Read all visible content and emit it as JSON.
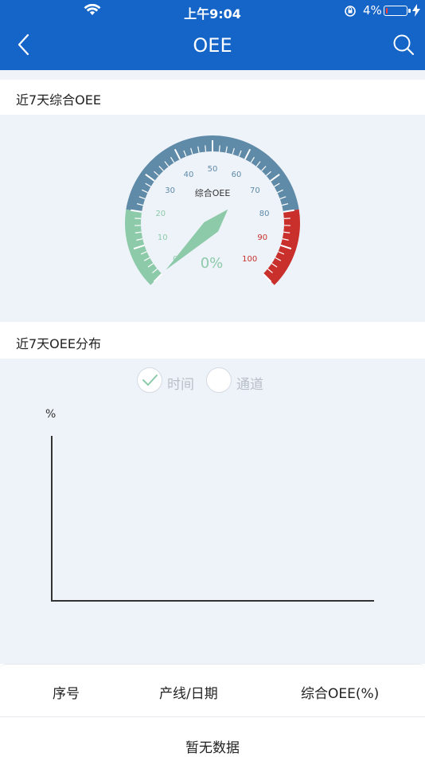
{
  "status_bar": {
    "time": "上午9:04",
    "battery_percent": "4%",
    "battery_level": 0.04,
    "icons": [
      "wifi-icon",
      "rotation-lock-icon",
      "battery-icon",
      "charging-bolt-icon"
    ]
  },
  "nav": {
    "title": "OEE",
    "icons": [
      "back-chevron-icon",
      "search-icon"
    ]
  },
  "oee_section": {
    "title": "近7天综合OEE",
    "gauge": {
      "label": "综合OEE",
      "value_text": "0%",
      "value": 0,
      "min": 0,
      "max": 100,
      "ticks": [
        "0",
        "10",
        "20",
        "30",
        "40",
        "50",
        "60",
        "70",
        "80",
        "90",
        "100"
      ],
      "band_colors": {
        "low": "#8dcaa9",
        "mid": "#5f8aa8",
        "high": "#c9302c"
      },
      "pointer_color": "#8dcaa9"
    }
  },
  "distribution_section": {
    "title": "近7天OEE分布",
    "toggle": [
      {
        "label": "时间",
        "checked": true
      },
      {
        "label": "通道",
        "checked": false
      }
    ],
    "chart_data": {
      "type": "line",
      "title": "",
      "ylabel": "%",
      "xlabel": "",
      "series": []
    }
  },
  "table": {
    "headers": [
      "序号",
      "产线/日期",
      "综合OEE(%)"
    ],
    "empty_text": "暂无数据"
  },
  "colors": {
    "nav_bg": "#1564c8",
    "panel_bg": "#eef3f9",
    "check_accent": "#8dcaa9"
  }
}
